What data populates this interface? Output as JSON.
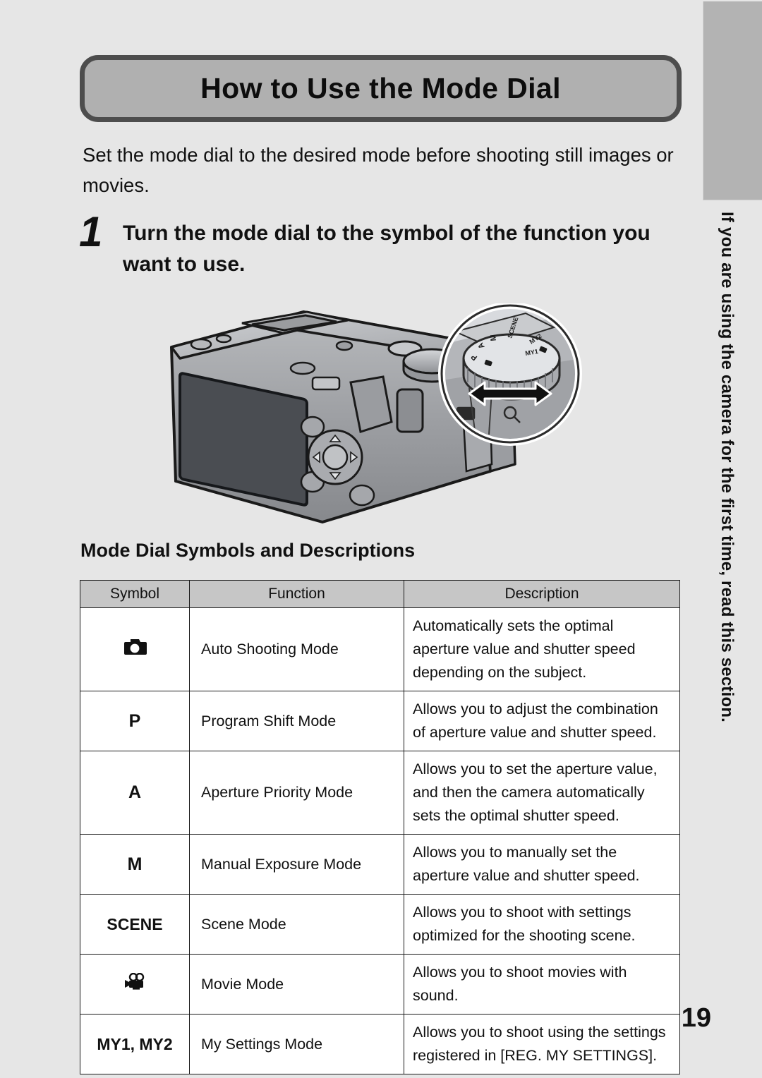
{
  "page": {
    "number": "19",
    "background_color": "#e6e6e6",
    "title": "How to Use the Mode Dial",
    "intro": "Set the mode dial to the desired mode before shooting still images or movies.",
    "side_tab_text": "If you are using the camera for the first time, read this section."
  },
  "step": {
    "number": "1",
    "text": "Turn the mode dial to the symbol of the function you want to use."
  },
  "illustration": {
    "camera_label": "digital-camera-rear-view",
    "callout_label": "mode-dial-closeup",
    "dial_symbols": [
      "SCENE",
      "M",
      "A",
      "P",
      "camera",
      "MY1",
      "MY2",
      "movie"
    ],
    "arrow_label": "rotate-dial-arrow"
  },
  "subsection": {
    "heading": "Mode Dial Symbols and Descriptions"
  },
  "table": {
    "headers": [
      "Symbol",
      "Function",
      "Description"
    ],
    "rows": [
      {
        "symbol": "",
        "symbol_icon": "camera-icon",
        "function": "Auto Shooting Mode",
        "description": "Automatically sets the optimal aperture value and shutter speed depending on the subject."
      },
      {
        "symbol": "P",
        "symbol_icon": "",
        "function": "Program Shift Mode",
        "description": "Allows you to adjust the combination of aperture value and shutter speed."
      },
      {
        "symbol": "A",
        "symbol_icon": "",
        "function": "Aperture Priority Mode",
        "description": "Allows you to set the aperture value, and then the camera automatically sets the optimal shutter speed."
      },
      {
        "symbol": "M",
        "symbol_icon": "",
        "function": "Manual Exposure Mode",
        "description": "Allows you to manually set the aperture value and shutter speed."
      },
      {
        "symbol": "SCENE",
        "symbol_icon": "",
        "function": "Scene Mode",
        "description": "Allows you to shoot with settings optimized for the shooting scene."
      },
      {
        "symbol": "",
        "symbol_icon": "movie-camera-icon",
        "function": "Movie Mode",
        "description": "Allows you to shoot movies with sound."
      },
      {
        "symbol": "MY1, MY2",
        "symbol_icon": "",
        "function": "My Settings Mode",
        "description": "Allows you to shoot using the settings registered in [REG. MY SETTINGS]."
      }
    ]
  }
}
